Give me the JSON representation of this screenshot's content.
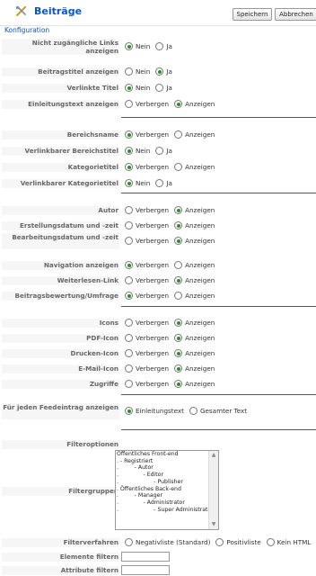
{
  "header": {
    "title": "Beiträge",
    "save_label": "Speichern",
    "cancel_label": "Abbrechen"
  },
  "config": {
    "legend": "Konfiguration",
    "rows": [
      {
        "label": "Nicht zugängliche Links anzeigen",
        "opt1": "Nein",
        "opt2": "Ja",
        "selected": 1
      },
      {
        "label": "Beitragstitel anzeigen",
        "opt1": "Nein",
        "opt2": "Ja",
        "selected": 2
      },
      {
        "label": "Verlinkte Titel",
        "opt1": "Nein",
        "opt2": "Ja",
        "selected": 1
      },
      {
        "label": "Einleitungstext anzeigen",
        "opt1": "Verbergen",
        "opt2": "Anzeigen",
        "selected": 2
      },
      {
        "label": "Bereichsname",
        "opt1": "Verbergen",
        "opt2": "Anzeigen",
        "selected": 1
      },
      {
        "label": "Verlinkbarer Bereichstitel",
        "opt1": "Nein",
        "opt2": "Ja",
        "selected": 1
      },
      {
        "label": "Kategorietitel",
        "opt1": "Verbergen",
        "opt2": "Anzeigen",
        "selected": 1
      },
      {
        "label": "Verlinkbarer Kategorietitel",
        "opt1": "Nein",
        "opt2": "Ja",
        "selected": 1
      },
      {
        "label": "Autor",
        "opt1": "Verbergen",
        "opt2": "Anzeigen",
        "selected": 2
      },
      {
        "label": "Erstellungsdatum und -zeit",
        "opt1": "Verbergen",
        "opt2": "Anzeigen",
        "selected": 2
      },
      {
        "label": "Bearbeitungsdatum und -zeit",
        "opt1": "Verbergen",
        "opt2": "Anzeigen",
        "selected": 2
      },
      {
        "label": "Navigation anzeigen",
        "opt1": "Verbergen",
        "opt2": "Anzeigen",
        "selected": 1
      },
      {
        "label": "Weiterlesen-Link",
        "opt1": "Verbergen",
        "opt2": "Anzeigen",
        "selected": 2
      },
      {
        "label": "Beitragsbewertung/Umfrage",
        "opt1": "Verbergen",
        "opt2": "Anzeigen",
        "selected": 1
      },
      {
        "label": "Icons",
        "opt1": "Verbergen",
        "opt2": "Anzeigen",
        "selected": 2
      },
      {
        "label": "PDF-Icon",
        "opt1": "Verbergen",
        "opt2": "Anzeigen",
        "selected": 2
      },
      {
        "label": "Drucken-Icon",
        "opt1": "Verbergen",
        "opt2": "Anzeigen",
        "selected": 2
      },
      {
        "label": "E-Mail-Icon",
        "opt1": "Verbergen",
        "opt2": "Anzeigen",
        "selected": 2
      },
      {
        "label": "Zugriffe",
        "opt1": "Verbergen",
        "opt2": "Anzeigen",
        "selected": 2
      },
      {
        "label": "Für jeden Feedeintrag anzeigen",
        "opt1": "Einleitungstext",
        "opt2": "Gesamter Text",
        "selected": 1
      }
    ],
    "filter_options_label": "Filteroptionen",
    "filter_groups_label": "Filtergruppen",
    "filter_groups": [
      "Öffentliches Front-end",
      ". - Registriert",
      ".         - Autor",
      ".              - Editor",
      ".                    - Publisher",
      ". Öffentliches Back-end",
      ".         - Manager",
      ".              - Administrator",
      ".                    - Super Administrator"
    ],
    "filter_method_label": "Filterverfahren",
    "filter_method_options": [
      "Negativliste (Standard)",
      "Positivliste",
      "Kein HTML"
    ],
    "filter_method_selected": 0,
    "element_filter_label": "Elemente filtern",
    "element_filter_value": "",
    "attribute_filter_label": "Attribute filtern",
    "attribute_filter_value": ""
  }
}
